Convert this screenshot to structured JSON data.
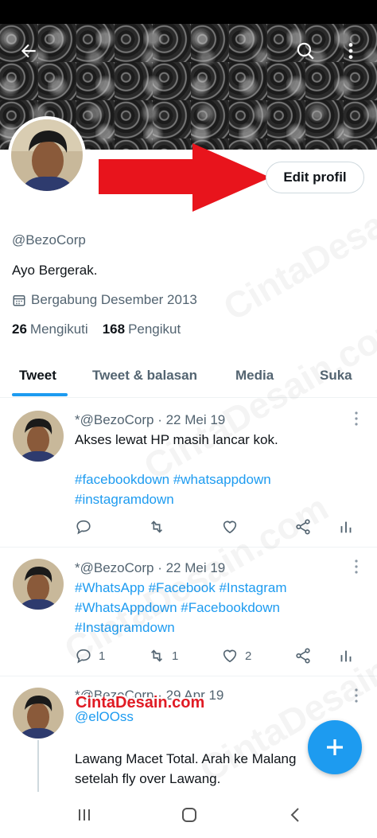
{
  "profile": {
    "handle": "@BezoCorp",
    "bio": "Ayo Bergerak.",
    "joined": "Bergabung Desember 2013",
    "following_count": "26",
    "following_label": "Mengikuti",
    "followers_count": "168",
    "followers_label": "Pengikut",
    "edit_label": "Edit profil"
  },
  "tabs": [
    "Tweet",
    "Tweet & balasan",
    "Media",
    "Suka"
  ],
  "tweets": [
    {
      "header": "*@BezoCorp · 22 Mei 19",
      "text": "Akses lewat HP masih lancar kok.",
      "tags_line1": "#facebookdown #whatsappdown",
      "tags_line2": "#instagramdown",
      "replies": "",
      "retweets": "",
      "likes": ""
    },
    {
      "header": "*@BezoCorp · 22 Mei 19",
      "tags_line1": "#WhatsApp #Facebook #Instagram",
      "tags_line2": "#WhatsAppdown #Facebookdown",
      "tags_line3": "#Instagramdown",
      "replies": "1",
      "retweets": "1",
      "likes": "2"
    },
    {
      "header": "*@BezoCorp · 29 Apr 19",
      "mention": "@elOOss",
      "text_line1": "Lawang Macet Total. Arah ke Malang",
      "text_line2": "setelah fly over Lawang."
    }
  ],
  "watermark_logo": "CintaDesain.com",
  "watermark_text": "CintaDesain.com",
  "colors": {
    "accent": "#1d9bf0",
    "arrow": "#e8141c",
    "text": "#0f1419",
    "muted": "#536471"
  }
}
